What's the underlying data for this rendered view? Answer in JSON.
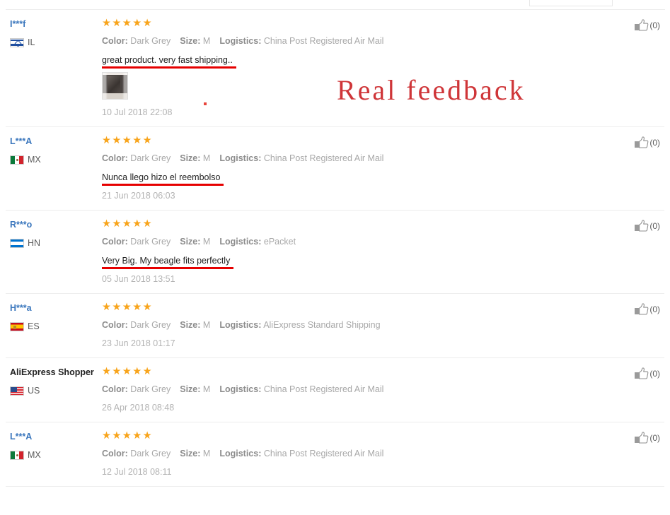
{
  "annotations": {
    "real_feedback_label": "Real  feedback",
    "underline_color": "#e60000",
    "label_color": "#cf3538"
  },
  "theme": {
    "star_color": "#f8a41b",
    "user_link_color": "#3b77bd",
    "muted_text_color": "#a8a8a8",
    "divider_color": "#ededed"
  },
  "labels": {
    "color_label": "Color:",
    "size_label": "Size:",
    "logistics_label": "Logistics:",
    "stars_glyph": "★★★★★"
  },
  "reviews": [
    {
      "user": "I***f",
      "user_is_link": true,
      "country_code": "IL",
      "flag": "flag-il",
      "rating": 5,
      "color": "Dark Grey",
      "size": "M",
      "logistics": "China Post Registered Air Mail",
      "comment": "great product. very fast shipping..",
      "has_photo": true,
      "date": "10 Jul 2018 22:08",
      "likes": "(0)"
    },
    {
      "user": "L***A",
      "user_is_link": true,
      "country_code": "MX",
      "flag": "flag-mx",
      "rating": 5,
      "color": "Dark Grey",
      "size": "M",
      "logistics": "China Post Registered Air Mail",
      "comment": "Nunca llego hizo el reembolso",
      "has_photo": false,
      "date": "21 Jun 2018 06:03",
      "likes": "(0)"
    },
    {
      "user": "R***o",
      "user_is_link": true,
      "country_code": "HN",
      "flag": "flag-hn",
      "rating": 5,
      "color": "Dark Grey",
      "size": "M",
      "logistics": "ePacket",
      "comment": "Very Big. My beagle fits perfectly",
      "has_photo": false,
      "date": "05 Jun 2018 13:51",
      "likes": "(0)"
    },
    {
      "user": "H***a",
      "user_is_link": true,
      "country_code": "ES",
      "flag": "flag-es",
      "rating": 5,
      "color": "Dark Grey",
      "size": "M",
      "logistics": "AliExpress Standard Shipping",
      "comment": "",
      "has_photo": false,
      "date": "23 Jun 2018 01:17",
      "likes": "(0)"
    },
    {
      "user": "AliExpress Shopper",
      "user_is_link": false,
      "country_code": "US",
      "flag": "flag-us",
      "rating": 5,
      "color": "Dark Grey",
      "size": "M",
      "logistics": "China Post Registered Air Mail",
      "comment": "",
      "has_photo": false,
      "date": "26 Apr 2018 08:48",
      "likes": "(0)"
    },
    {
      "user": "L***A",
      "user_is_link": true,
      "country_code": "MX",
      "flag": "flag-mx",
      "rating": 5,
      "color": "Dark Grey",
      "size": "M",
      "logistics": "China Post Registered Air Mail",
      "comment": "",
      "has_photo": false,
      "date": "12 Jul 2018 08:11",
      "likes": "(0)"
    }
  ]
}
